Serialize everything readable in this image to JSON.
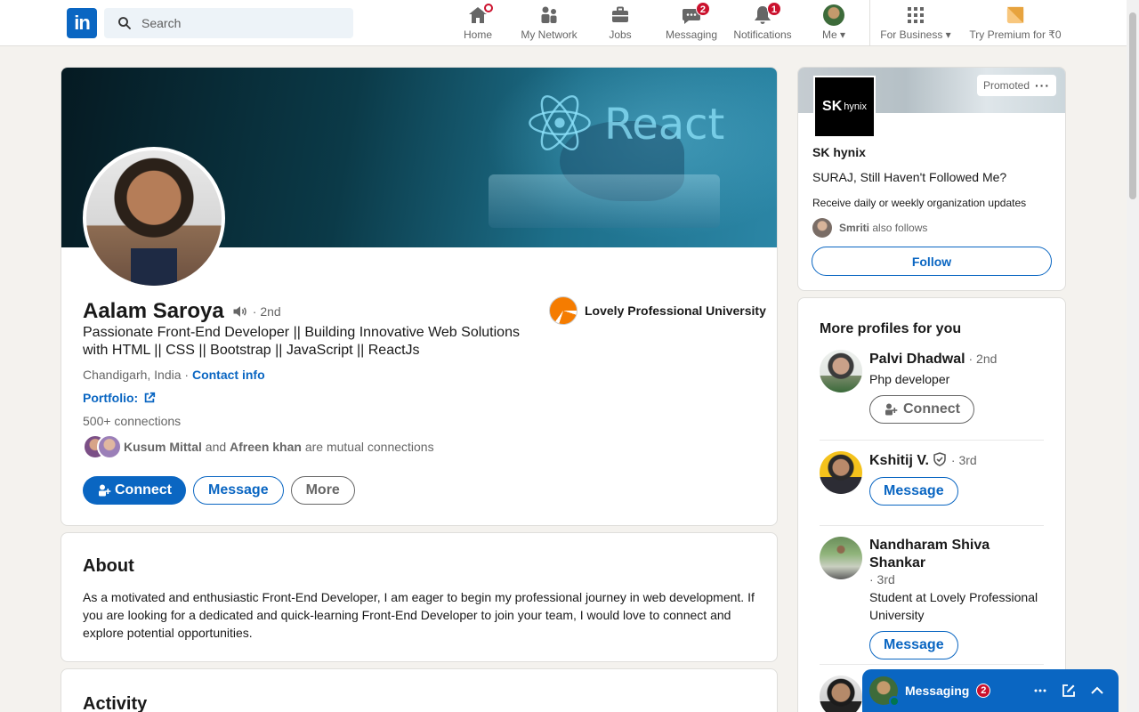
{
  "nav": {
    "search_placeholder": "Search",
    "items": [
      {
        "label": "Home"
      },
      {
        "label": "My Network"
      },
      {
        "label": "Jobs"
      },
      {
        "label": "Messaging",
        "badge": "2"
      },
      {
        "label": "Notifications",
        "badge": "1"
      },
      {
        "label": "Me"
      },
      {
        "label": "For Business"
      },
      {
        "label": "Try Premium for ₹0"
      }
    ],
    "logo_text": "in"
  },
  "banner": {
    "text": "React"
  },
  "profile": {
    "name": "Aalam Saroya",
    "degree": "· 2nd",
    "headline": "Passionate Front-End Developer || Building Innovative Web Solutions with HTML || CSS || Bootstrap || JavaScript || ReactJs",
    "location": "Chandigarh, India · ",
    "contact_info": "Contact info",
    "portfolio": "Portfolio:",
    "connections": "500+ connections",
    "mutual_1": "Kusum Mittal",
    "mutual_and": " and ",
    "mutual_2": "Afreen khan",
    "mutual_suffix": " are mutual connections",
    "connect": "Connect",
    "message": "Message",
    "more": "More",
    "school": "Lovely Professional University"
  },
  "about": {
    "title": "About",
    "text": "As a motivated and enthusiastic Front-End Developer, I am eager to begin my professional journey in web development. If you are looking for a dedicated and quick-learning Front-End Developer to join your team, I would love to connect and explore potential opportunities."
  },
  "activity": {
    "title": "Activity"
  },
  "ad": {
    "promoted": "Promoted",
    "logo_main": "SK",
    "logo_sub": "hynix",
    "company": "SK hynix",
    "line1": "SURAJ, Still Haven't Followed Me?",
    "line2": "Receive daily or weekly organization updates",
    "follower": "Smriti",
    "follows_suffix": " also follows",
    "follow": "Follow"
  },
  "more_profiles": {
    "title": "More profiles for you",
    "people": [
      {
        "name": "Palvi Dhadwal",
        "degree": " · 2nd",
        "title": "Php developer",
        "button": "Connect"
      },
      {
        "name": "Kshitij V.",
        "degree": " · 3rd",
        "title": "",
        "button": "Message"
      },
      {
        "name": "Nandharam Shiva Shankar",
        "degree": "· 3rd",
        "title": "Student at Lovely Professional University",
        "button": "Message"
      }
    ]
  },
  "messaging_dock": {
    "label": "Messaging",
    "badge": "2"
  },
  "colors": {
    "brand": "#0a66c2",
    "badge": "#cb112d",
    "background": "#f4f2ee"
  }
}
